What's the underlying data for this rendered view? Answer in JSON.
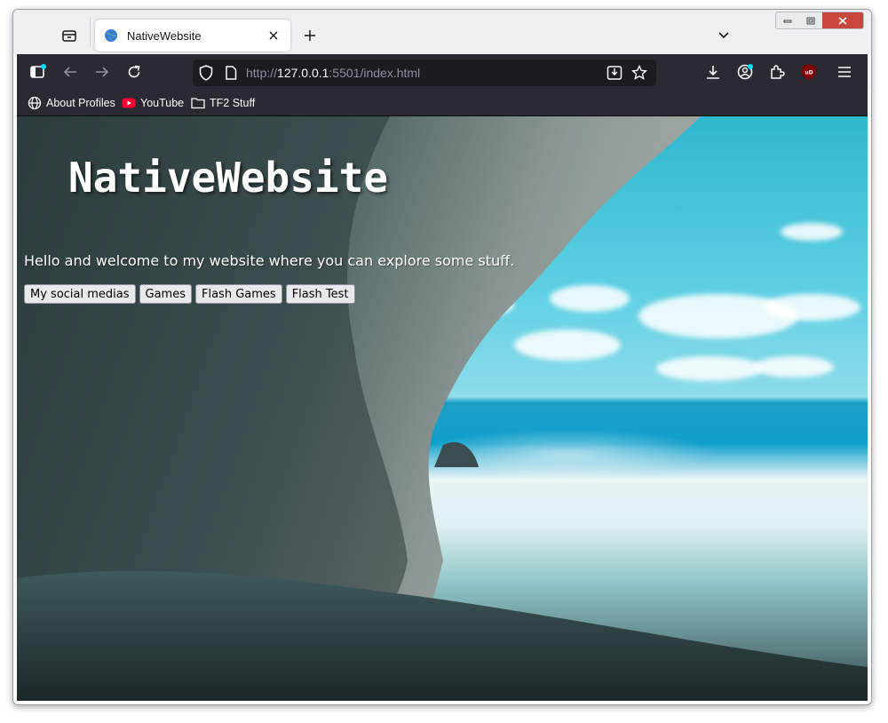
{
  "browser": {
    "tab": {
      "title": "NativeWebsite"
    },
    "url": {
      "protocol": "http://",
      "host": "127.0.0.1",
      "rest": ":5501/index.html"
    },
    "bookmarks": [
      {
        "label": "About Profiles",
        "icon": "globe-icon"
      },
      {
        "label": "YouTube",
        "icon": "youtube-icon"
      },
      {
        "label": "TF2 Stuff",
        "icon": "folder-icon"
      }
    ],
    "accent": "#00ddff"
  },
  "page": {
    "title": "NativeWebsite",
    "welcome": "Hello and welcome to my website where you can explore some stuff.",
    "buttons": [
      "My social medias",
      "Games",
      "Flash Games",
      "Flash Test"
    ]
  }
}
